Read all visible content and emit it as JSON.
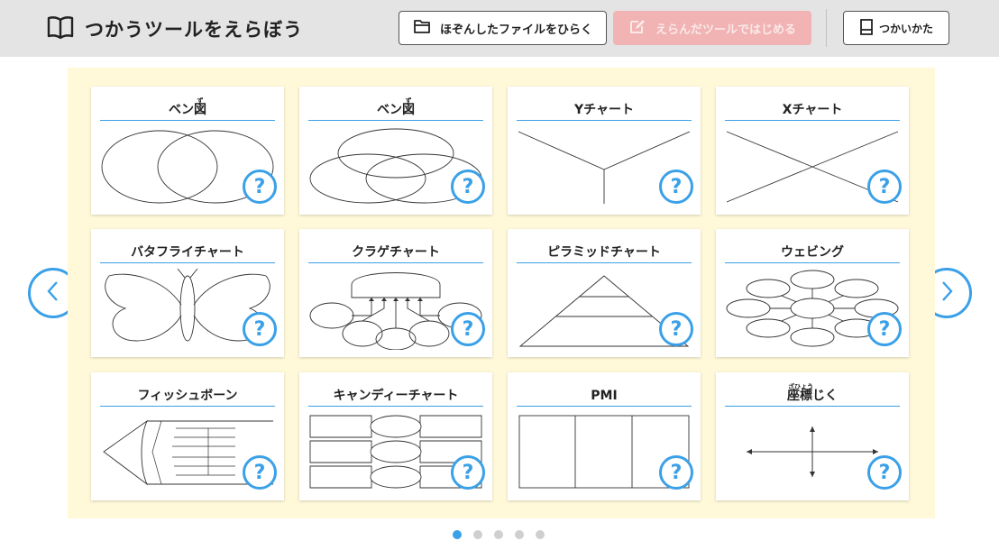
{
  "header": {
    "title": "つかうツールをえらぼう",
    "open_button_label": "ほぞんしたファイルをひらく",
    "start_button_label": "えらんだツールではじめる",
    "help_button_label": "つかいかた"
  },
  "cards": [
    {
      "title": "ベン図",
      "ruby": "ず",
      "help": "?"
    },
    {
      "title": "ベン図",
      "ruby": "ず",
      "help": "?"
    },
    {
      "title": "Yチャート",
      "help": "?"
    },
    {
      "title": "Xチャート",
      "help": "?"
    },
    {
      "title": "バタフライチャート",
      "help": "?"
    },
    {
      "title": "クラゲチャート",
      "help": "?"
    },
    {
      "title": "ピラミッドチャート",
      "help": "?"
    },
    {
      "title": "ウェビング",
      "help": "?"
    },
    {
      "title": "フィッシュボーン",
      "help": "?"
    },
    {
      "title": "キャンディーチャート",
      "help": "?"
    },
    {
      "title": "PMI",
      "help": "?"
    },
    {
      "title": "座標じく",
      "ruby": "ざひょう",
      "help": "?"
    }
  ],
  "pagination": {
    "total": 5,
    "current": 1
  },
  "colors": {
    "accent": "#3aa0e8",
    "board": "#fff9da",
    "header": "#e4e4e4",
    "disabled_button": "#f1b3b3"
  },
  "icons": {
    "title": "open-book-icon",
    "open": "folder-icon",
    "start": "edit-icon",
    "help": "booklet-icon",
    "prev": "chevron-left-icon",
    "next": "chevron-right-icon"
  }
}
